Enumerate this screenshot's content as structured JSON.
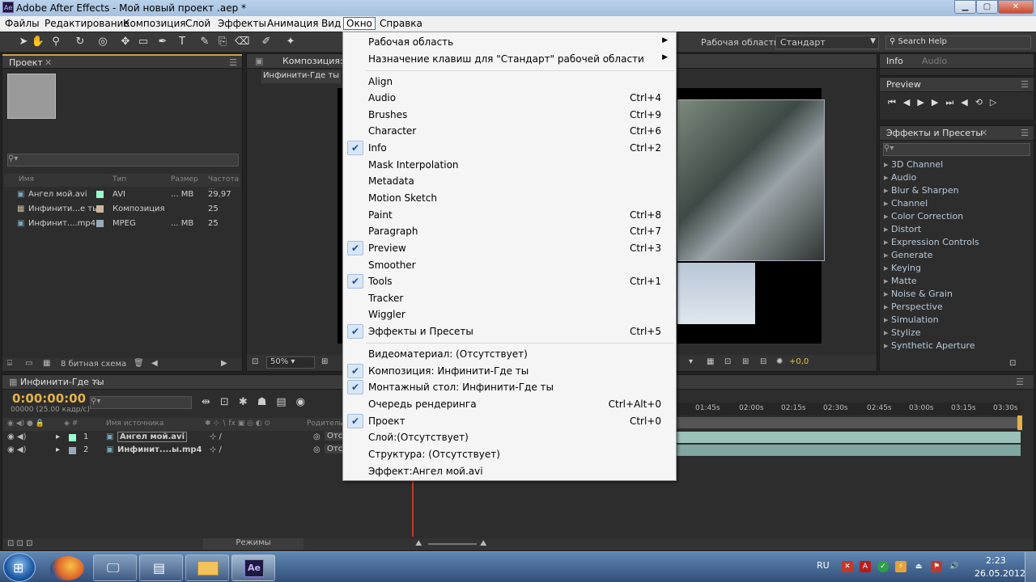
{
  "app": {
    "title": "Adobe After Effects - Мой новый проект .aep *",
    "icon_text": "Ae",
    "window_buttons": [
      "minimize",
      "maximize",
      "close"
    ]
  },
  "menubar": [
    "Файлы",
    "Редактирование",
    "Композиция",
    "Слой",
    "Эффекты",
    "Анимация",
    "Вид",
    "Окно",
    "Справка"
  ],
  "toolbar": {
    "workspace_label": "Рабочая область:",
    "workspace_value": "Стандарт",
    "search_help": "Search Help"
  },
  "project_panel": {
    "tab": "Проект",
    "columns": [
      "Имя",
      "Тип",
      "Размер",
      "Частота ..."
    ],
    "items": [
      {
        "name": "Ангел мой.avi",
        "type": "AVI",
        "size": "... MB",
        "rate": "29,97"
      },
      {
        "name": "Инфинити...е ты",
        "type": "Композиция",
        "size": "",
        "rate": "25"
      },
      {
        "name": "Инфинит....mp4",
        "type": "MPEG",
        "size": "... MB",
        "rate": "25"
      }
    ],
    "bit_depth": "8 битная схема"
  },
  "composition_panel": {
    "tab": "Композиция: Ин",
    "subtab": "Инфинити-Где ты",
    "zoom": "50%",
    "exposure": "+0,0"
  },
  "info_panel": {
    "tabs": [
      "Info",
      "Audio"
    ]
  },
  "preview_panel": {
    "tab": "Preview"
  },
  "effects_panel": {
    "tab": "Эффекты и Пресеты",
    "items": [
      "3D Channel",
      "Audio",
      "Blur & Sharpen",
      "Channel",
      "Color Correction",
      "Distort",
      "Expression Controls",
      "Generate",
      "Keying",
      "Matte",
      "Noise & Grain",
      "Perspective",
      "Simulation",
      "Stylize",
      "Synthetic Aperture"
    ]
  },
  "timeline": {
    "tab": "Инфинити-Где ты",
    "timecode": "0:00:00:00",
    "fps": "00000 (25.00 кадр/с)",
    "source_col": "Имя источника",
    "parent_col": "Родитель",
    "layers": [
      {
        "num": "1",
        "name": "Ангел мой.avi",
        "parent": "Отс"
      },
      {
        "num": "2",
        "name": "Инфинит....ы.mp4",
        "parent": "Отс"
      }
    ],
    "ruler": [
      "01:45s",
      "02:00s",
      "02:15s",
      "02:30s",
      "02:45s",
      "03:00s",
      "03:15s",
      "03:30s"
    ],
    "modes_label": "Режимы"
  },
  "window_menu": [
    {
      "label": "Рабочая область",
      "shortcut": "",
      "checked": false,
      "submenu": true
    },
    {
      "label": "Назначение клавиш для \"Стандарт\" рабочей области",
      "shortcut": "",
      "checked": false,
      "submenu": true
    },
    {
      "label": "Align",
      "shortcut": "",
      "checked": false
    },
    {
      "label": "Audio",
      "shortcut": "Ctrl+4",
      "checked": false
    },
    {
      "label": "Brushes",
      "shortcut": "Ctrl+9",
      "checked": false
    },
    {
      "label": "Character",
      "shortcut": "Ctrl+6",
      "checked": false
    },
    {
      "label": "Info",
      "shortcut": "Ctrl+2",
      "checked": true
    },
    {
      "label": "Mask Interpolation",
      "shortcut": "",
      "checked": false
    },
    {
      "label": "Metadata",
      "shortcut": "",
      "checked": false
    },
    {
      "label": "Motion Sketch",
      "shortcut": "",
      "checked": false
    },
    {
      "label": "Paint",
      "shortcut": "Ctrl+8",
      "checked": false
    },
    {
      "label": "Paragraph",
      "shortcut": "Ctrl+7",
      "checked": false
    },
    {
      "label": "Preview",
      "shortcut": "Ctrl+3",
      "checked": true
    },
    {
      "label": "Smoother",
      "shortcut": "",
      "checked": false
    },
    {
      "label": "Tools",
      "shortcut": "Ctrl+1",
      "checked": true
    },
    {
      "label": "Tracker",
      "shortcut": "",
      "checked": false
    },
    {
      "label": "Wiggler",
      "shortcut": "",
      "checked": false
    },
    {
      "label": "Эффекты и Пресеты",
      "shortcut": "Ctrl+5",
      "checked": true
    },
    {
      "label": "Видеоматериал: (Отсутствует)",
      "shortcut": "",
      "checked": false
    },
    {
      "label": "Композиция: Инфинити-Где ты",
      "shortcut": "",
      "checked": true
    },
    {
      "label": "Монтажный стол: Инфинити-Где ты",
      "shortcut": "",
      "checked": true
    },
    {
      "label": "Очередь рендеринга",
      "shortcut": "Ctrl+Alt+0",
      "checked": false
    },
    {
      "label": "Проект",
      "shortcut": "Ctrl+0",
      "checked": true
    },
    {
      "label": "Слой:(Отсутствует)",
      "shortcut": "",
      "checked": false
    },
    {
      "label": "Структура: (Отсутствует)",
      "shortcut": "",
      "checked": false
    },
    {
      "label": "Эффект:Ангел мой.avi",
      "shortcut": "",
      "checked": false
    }
  ],
  "taskbar": {
    "lang": "RU",
    "time": "2:23",
    "date": "26.05.2012",
    "apps": [
      "firefox",
      "monitor",
      "paint",
      "explorer",
      "after-effects"
    ]
  }
}
